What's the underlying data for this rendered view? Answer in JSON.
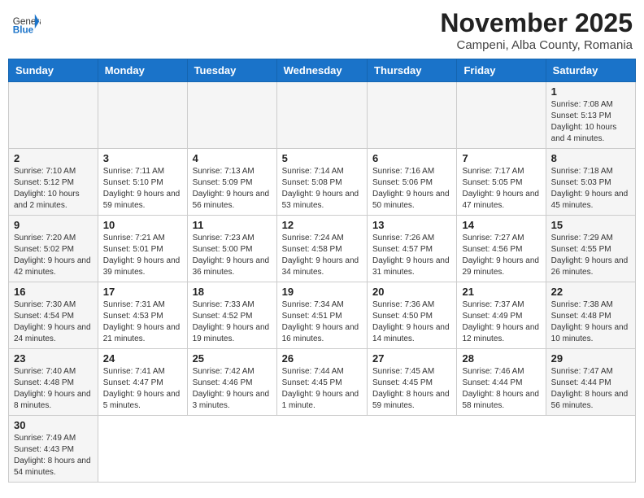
{
  "header": {
    "logo_text_general": "General",
    "logo_text_blue": "Blue",
    "month_title": "November 2025",
    "location": "Campeni, Alba County, Romania"
  },
  "weekdays": [
    "Sunday",
    "Monday",
    "Tuesday",
    "Wednesday",
    "Thursday",
    "Friday",
    "Saturday"
  ],
  "days": [
    {
      "date": "",
      "info": ""
    },
    {
      "date": "",
      "info": ""
    },
    {
      "date": "",
      "info": ""
    },
    {
      "date": "",
      "info": ""
    },
    {
      "date": "",
      "info": ""
    },
    {
      "date": "",
      "info": ""
    },
    {
      "date": "1",
      "info": "Sunrise: 7:08 AM\nSunset: 5:13 PM\nDaylight: 10 hours and 4 minutes."
    },
    {
      "date": "2",
      "info": "Sunrise: 7:10 AM\nSunset: 5:12 PM\nDaylight: 10 hours and 2 minutes."
    },
    {
      "date": "3",
      "info": "Sunrise: 7:11 AM\nSunset: 5:10 PM\nDaylight: 9 hours and 59 minutes."
    },
    {
      "date": "4",
      "info": "Sunrise: 7:13 AM\nSunset: 5:09 PM\nDaylight: 9 hours and 56 minutes."
    },
    {
      "date": "5",
      "info": "Sunrise: 7:14 AM\nSunset: 5:08 PM\nDaylight: 9 hours and 53 minutes."
    },
    {
      "date": "6",
      "info": "Sunrise: 7:16 AM\nSunset: 5:06 PM\nDaylight: 9 hours and 50 minutes."
    },
    {
      "date": "7",
      "info": "Sunrise: 7:17 AM\nSunset: 5:05 PM\nDaylight: 9 hours and 47 minutes."
    },
    {
      "date": "8",
      "info": "Sunrise: 7:18 AM\nSunset: 5:03 PM\nDaylight: 9 hours and 45 minutes."
    },
    {
      "date": "9",
      "info": "Sunrise: 7:20 AM\nSunset: 5:02 PM\nDaylight: 9 hours and 42 minutes."
    },
    {
      "date": "10",
      "info": "Sunrise: 7:21 AM\nSunset: 5:01 PM\nDaylight: 9 hours and 39 minutes."
    },
    {
      "date": "11",
      "info": "Sunrise: 7:23 AM\nSunset: 5:00 PM\nDaylight: 9 hours and 36 minutes."
    },
    {
      "date": "12",
      "info": "Sunrise: 7:24 AM\nSunset: 4:58 PM\nDaylight: 9 hours and 34 minutes."
    },
    {
      "date": "13",
      "info": "Sunrise: 7:26 AM\nSunset: 4:57 PM\nDaylight: 9 hours and 31 minutes."
    },
    {
      "date": "14",
      "info": "Sunrise: 7:27 AM\nSunset: 4:56 PM\nDaylight: 9 hours and 29 minutes."
    },
    {
      "date": "15",
      "info": "Sunrise: 7:29 AM\nSunset: 4:55 PM\nDaylight: 9 hours and 26 minutes."
    },
    {
      "date": "16",
      "info": "Sunrise: 7:30 AM\nSunset: 4:54 PM\nDaylight: 9 hours and 24 minutes."
    },
    {
      "date": "17",
      "info": "Sunrise: 7:31 AM\nSunset: 4:53 PM\nDaylight: 9 hours and 21 minutes."
    },
    {
      "date": "18",
      "info": "Sunrise: 7:33 AM\nSunset: 4:52 PM\nDaylight: 9 hours and 19 minutes."
    },
    {
      "date": "19",
      "info": "Sunrise: 7:34 AM\nSunset: 4:51 PM\nDaylight: 9 hours and 16 minutes."
    },
    {
      "date": "20",
      "info": "Sunrise: 7:36 AM\nSunset: 4:50 PM\nDaylight: 9 hours and 14 minutes."
    },
    {
      "date": "21",
      "info": "Sunrise: 7:37 AM\nSunset: 4:49 PM\nDaylight: 9 hours and 12 minutes."
    },
    {
      "date": "22",
      "info": "Sunrise: 7:38 AM\nSunset: 4:48 PM\nDaylight: 9 hours and 10 minutes."
    },
    {
      "date": "23",
      "info": "Sunrise: 7:40 AM\nSunset: 4:48 PM\nDaylight: 9 hours and 8 minutes."
    },
    {
      "date": "24",
      "info": "Sunrise: 7:41 AM\nSunset: 4:47 PM\nDaylight: 9 hours and 5 minutes."
    },
    {
      "date": "25",
      "info": "Sunrise: 7:42 AM\nSunset: 4:46 PM\nDaylight: 9 hours and 3 minutes."
    },
    {
      "date": "26",
      "info": "Sunrise: 7:44 AM\nSunset: 4:45 PM\nDaylight: 9 hours and 1 minute."
    },
    {
      "date": "27",
      "info": "Sunrise: 7:45 AM\nSunset: 4:45 PM\nDaylight: 8 hours and 59 minutes."
    },
    {
      "date": "28",
      "info": "Sunrise: 7:46 AM\nSunset: 4:44 PM\nDaylight: 8 hours and 58 minutes."
    },
    {
      "date": "29",
      "info": "Sunrise: 7:47 AM\nSunset: 4:44 PM\nDaylight: 8 hours and 56 minutes."
    },
    {
      "date": "30",
      "info": "Sunrise: 7:49 AM\nSunset: 4:43 PM\nDaylight: 8 hours and 54 minutes."
    }
  ]
}
